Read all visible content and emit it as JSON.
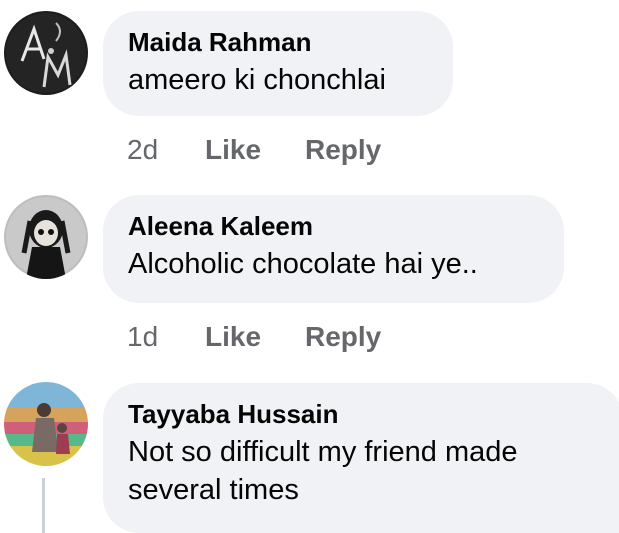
{
  "comments": [
    {
      "author": "Maida Rahman",
      "text": "ameero ki chonchlai",
      "time": "2d",
      "like_label": "Like",
      "reply_label": "Reply"
    },
    {
      "author": "Aleena Kaleem",
      "text": "Alcoholic chocolate hai ye..",
      "time": "1d",
      "like_label": "Like",
      "reply_label": "Reply"
    },
    {
      "author": "Tayyaba Hussain",
      "text": "Not so difficult my friend made several times"
    }
  ],
  "colors": {
    "bubble": "#f0f2f5",
    "meta_text": "#65676b",
    "name_text": "#050505"
  },
  "icons": {
    "avatar_1": "monogram-am-avatar",
    "avatar_2": "doll-avatar",
    "avatar_3": "photo-avatar"
  }
}
